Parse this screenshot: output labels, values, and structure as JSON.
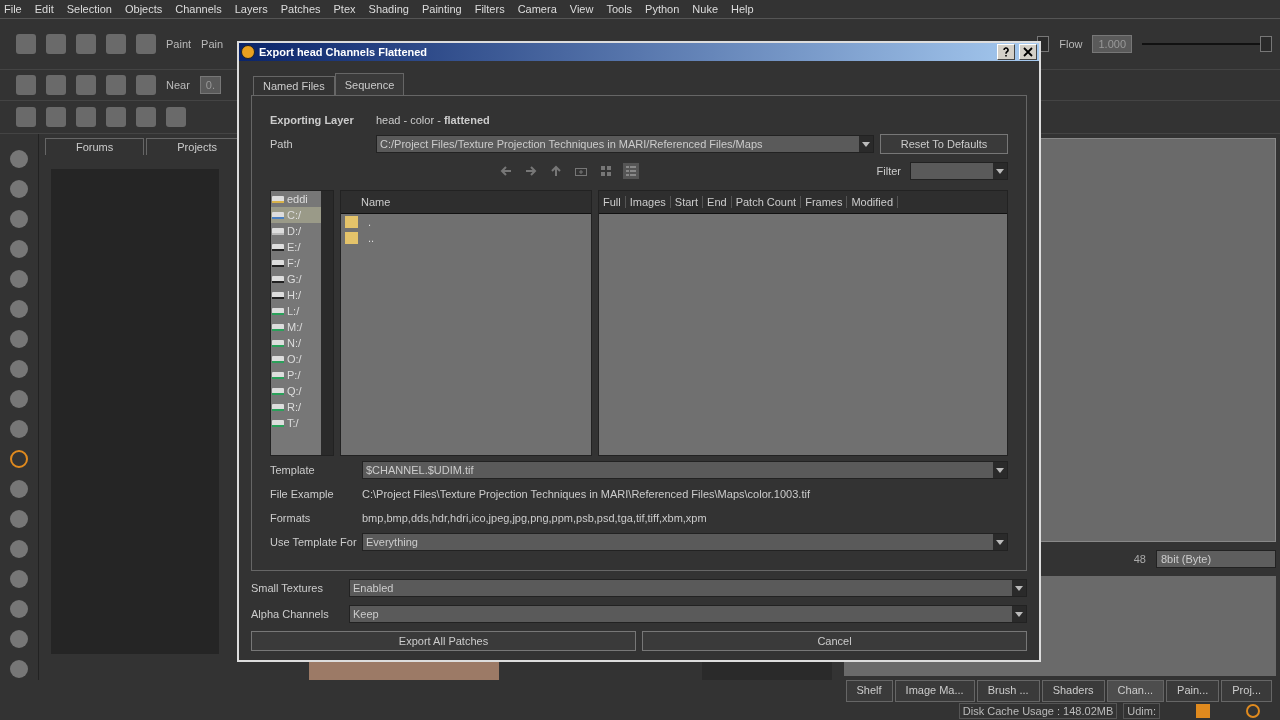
{
  "menu_bar": [
    "File",
    "Edit",
    "Selection",
    "Objects",
    "Channels",
    "Layers",
    "Patches",
    "Ptex",
    "Shading",
    "Painting",
    "Filters",
    "Camera",
    "View",
    "Tools",
    "Python",
    "Nuke",
    "Help"
  ],
  "toolbar": {
    "sliders": [
      {
        "level": 1
      },
      {
        "level": 1
      }
    ],
    "mode_labels": [
      "Paint",
      "Pain"
    ],
    "near_label": "Near",
    "near_value": "0.",
    "flow_label": "Flow",
    "flow_value": "1.000"
  },
  "left_panel": {
    "tabs": [
      {
        "label": "Forums",
        "selected": false
      },
      {
        "label": "Projects",
        "selected": false
      }
    ]
  },
  "right_panel": {
    "depth_dropdown": "8bit  (Byte)",
    "partial_value": "48"
  },
  "bottom_tabs": [
    {
      "label": "Shelf",
      "selected": false
    },
    {
      "label": "Image Ma...",
      "selected": false
    },
    {
      "label": "Brush ...",
      "selected": false
    },
    {
      "label": "Shaders",
      "selected": false
    },
    {
      "label": "Chan...",
      "selected": true
    },
    {
      "label": "Pain...",
      "selected": false
    },
    {
      "label": "Proj...",
      "selected": false
    }
  ],
  "status_bar": {
    "disk_cache": "Disk Cache Usage : 148.02MB",
    "udim": "Udim:"
  },
  "dialog": {
    "title": "Export head Channels Flattened",
    "tabs": [
      {
        "label": "Named Files",
        "selected": false
      },
      {
        "label": "Sequence",
        "selected": true
      }
    ],
    "exporting_layer": {
      "label": "Exporting Layer",
      "value": "head - color - **flattened**"
    },
    "path": {
      "label": "Path",
      "value": "C:/Project Files/Texture Projection Techniques in MARI/Referenced Files/Maps"
    },
    "reset_button": "Reset To Defaults",
    "filter": {
      "label": "Filter"
    },
    "drives": [
      {
        "label": "eddi",
        "kind": "user",
        "selected": false
      },
      {
        "label": "C:/",
        "kind": "system",
        "selected": true
      },
      {
        "label": "D:/",
        "kind": "optical",
        "selected": false
      },
      {
        "label": "E:/",
        "kind": "removable",
        "selected": false
      },
      {
        "label": "F:/",
        "kind": "removable",
        "selected": false
      },
      {
        "label": "G:/",
        "kind": "removable",
        "selected": false
      },
      {
        "label": "H:/",
        "kind": "removable",
        "selected": false
      },
      {
        "label": "L:/",
        "kind": "network",
        "selected": false
      },
      {
        "label": "M:/",
        "kind": "network",
        "selected": false
      },
      {
        "label": "N:/",
        "kind": "network",
        "selected": false
      },
      {
        "label": "O:/",
        "kind": "network",
        "selected": false
      },
      {
        "label": "P:/",
        "kind": "network",
        "selected": false
      },
      {
        "label": "Q:/",
        "kind": "network",
        "selected": false
      },
      {
        "label": "R:/",
        "kind": "network",
        "selected": false
      },
      {
        "label": "T:/",
        "kind": "network",
        "selected": false
      }
    ],
    "file_list": {
      "header": "Name",
      "items": [
        ".",
        ".."
      ]
    },
    "details_columns": [
      "Full",
      "Images",
      "Start",
      "End",
      "Patch Count",
      "Frames",
      "Modified"
    ],
    "template": {
      "label": "Template",
      "value": "$CHANNEL.$UDIM.tif"
    },
    "file_example": {
      "label": "File Example",
      "value": "C:\\Project Files\\Texture Projection Techniques in MARI\\Referenced Files\\Maps\\color.1003.tif"
    },
    "formats": {
      "label": "Formats",
      "value": "bmp,bmp,dds,hdr,hdri,ico,jpeg,jpg,png,ppm,psb,psd,tga,tif,tiff,xbm,xpm"
    },
    "use_template_for": {
      "label": "Use Template For",
      "value": "Everything"
    },
    "small_textures": {
      "label": "Small Textures",
      "value": "Enabled"
    },
    "alpha_channels": {
      "label": "Alpha Channels",
      "value": "Keep"
    },
    "buttons": [
      "Export All Patches",
      "Cancel"
    ]
  }
}
